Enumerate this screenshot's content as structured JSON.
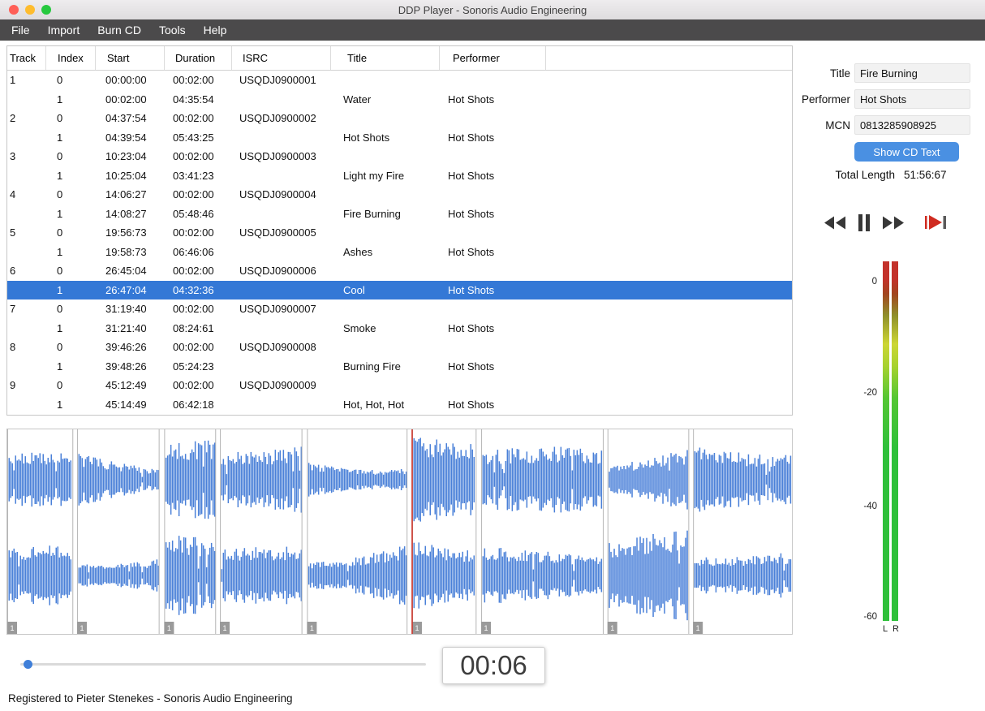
{
  "window": {
    "title": "DDP Player - Sonoris Audio Engineering"
  },
  "menu": {
    "items": [
      "File",
      "Import",
      "Burn CD",
      "Tools",
      "Help"
    ]
  },
  "table": {
    "columns": [
      "Track",
      "Index",
      "Start",
      "Duration",
      "ISRC",
      "Title",
      "Performer"
    ],
    "rows": [
      {
        "track": "1",
        "index": "0",
        "start": "00:00:00",
        "duration": "00:02:00",
        "isrc": "USQDJ0900001",
        "title": "",
        "performer": "",
        "selected": false
      },
      {
        "track": "",
        "index": "1",
        "start": "00:02:00",
        "duration": "04:35:54",
        "isrc": "",
        "title": "Water",
        "performer": "Hot Shots",
        "selected": false
      },
      {
        "track": "2",
        "index": "0",
        "start": "04:37:54",
        "duration": "00:02:00",
        "isrc": "USQDJ0900002",
        "title": "",
        "performer": "",
        "selected": false
      },
      {
        "track": "",
        "index": "1",
        "start": "04:39:54",
        "duration": "05:43:25",
        "isrc": "",
        "title": "Hot Shots",
        "performer": "Hot Shots",
        "selected": false
      },
      {
        "track": "3",
        "index": "0",
        "start": "10:23:04",
        "duration": "00:02:00",
        "isrc": "USQDJ0900003",
        "title": "",
        "performer": "",
        "selected": false
      },
      {
        "track": "",
        "index": "1",
        "start": "10:25:04",
        "duration": "03:41:23",
        "isrc": "",
        "title": "Light my Fire",
        "performer": "Hot Shots",
        "selected": false
      },
      {
        "track": "4",
        "index": "0",
        "start": "14:06:27",
        "duration": "00:02:00",
        "isrc": "USQDJ0900004",
        "title": "",
        "performer": "",
        "selected": false
      },
      {
        "track": "",
        "index": "1",
        "start": "14:08:27",
        "duration": "05:48:46",
        "isrc": "",
        "title": "Fire Burning",
        "performer": "Hot Shots",
        "selected": false
      },
      {
        "track": "5",
        "index": "0",
        "start": "19:56:73",
        "duration": "00:02:00",
        "isrc": "USQDJ0900005",
        "title": "",
        "performer": "",
        "selected": false
      },
      {
        "track": "",
        "index": "1",
        "start": "19:58:73",
        "duration": "06:46:06",
        "isrc": "",
        "title": "Ashes",
        "performer": "Hot Shots",
        "selected": false
      },
      {
        "track": "6",
        "index": "0",
        "start": "26:45:04",
        "duration": "00:02:00",
        "isrc": "USQDJ0900006",
        "title": "",
        "performer": "",
        "selected": false
      },
      {
        "track": "",
        "index": "1",
        "start": "26:47:04",
        "duration": "04:32:36",
        "isrc": "",
        "title": "Cool",
        "performer": "Hot Shots",
        "selected": true
      },
      {
        "track": "7",
        "index": "0",
        "start": "31:19:40",
        "duration": "00:02:00",
        "isrc": "USQDJ0900007",
        "title": "",
        "performer": "",
        "selected": false
      },
      {
        "track": "",
        "index": "1",
        "start": "31:21:40",
        "duration": "08:24:61",
        "isrc": "",
        "title": "Smoke",
        "performer": "Hot Shots",
        "selected": false
      },
      {
        "track": "8",
        "index": "0",
        "start": "39:46:26",
        "duration": "00:02:00",
        "isrc": "USQDJ0900008",
        "title": "",
        "performer": "",
        "selected": false
      },
      {
        "track": "",
        "index": "1",
        "start": "39:48:26",
        "duration": "05:24:23",
        "isrc": "",
        "title": "Burning Fire",
        "performer": "Hot Shots",
        "selected": false
      },
      {
        "track": "9",
        "index": "0",
        "start": "45:12:49",
        "duration": "00:02:00",
        "isrc": "USQDJ0900009",
        "title": "",
        "performer": "",
        "selected": false
      },
      {
        "track": "",
        "index": "1",
        "start": "45:14:49",
        "duration": "06:42:18",
        "isrc": "",
        "title": "Hot, Hot, Hot",
        "performer": "Hot Shots",
        "selected": false
      }
    ]
  },
  "inspector": {
    "title_label": "Title",
    "title_value": "Fire Burning",
    "performer_label": "Performer",
    "performer_value": "Hot Shots",
    "mcn_label": "MCN",
    "mcn_value": "0813285908925",
    "show_cd_text_label": "Show CD Text",
    "total_length_label": "Total Length",
    "total_length_value": "51:56:67"
  },
  "meter": {
    "scale_labels": [
      "0",
      "-20",
      "-40",
      "-60"
    ],
    "channel_labels": [
      "L",
      "R"
    ]
  },
  "player": {
    "time_display": "00:06",
    "slider_position": 0.014,
    "playhead_position": 0.516
  },
  "waveform": {
    "marker_label": "1",
    "segments": [
      {
        "start": 0.0,
        "end": 0.083
      },
      {
        "start": 0.089,
        "end": 0.193
      },
      {
        "start": 0.2,
        "end": 0.265
      },
      {
        "start": 0.271,
        "end": 0.375
      },
      {
        "start": 0.382,
        "end": 0.509
      },
      {
        "start": 0.516,
        "end": 0.597
      },
      {
        "start": 0.604,
        "end": 0.759
      },
      {
        "start": 0.765,
        "end": 0.868
      },
      {
        "start": 0.874,
        "end": 1.0
      }
    ]
  },
  "status_bar": {
    "text": "Registered to Pieter Stenekes - Sonoris Audio Engineering"
  },
  "colors": {
    "selection": "#3478d6",
    "waveform": "#4a80d8",
    "playhead": "#cf2b20",
    "button": "#4a90e2",
    "meter_green": "#2ec03a",
    "meter_yellow": "#ccd634",
    "meter_red": "#c3322b"
  }
}
